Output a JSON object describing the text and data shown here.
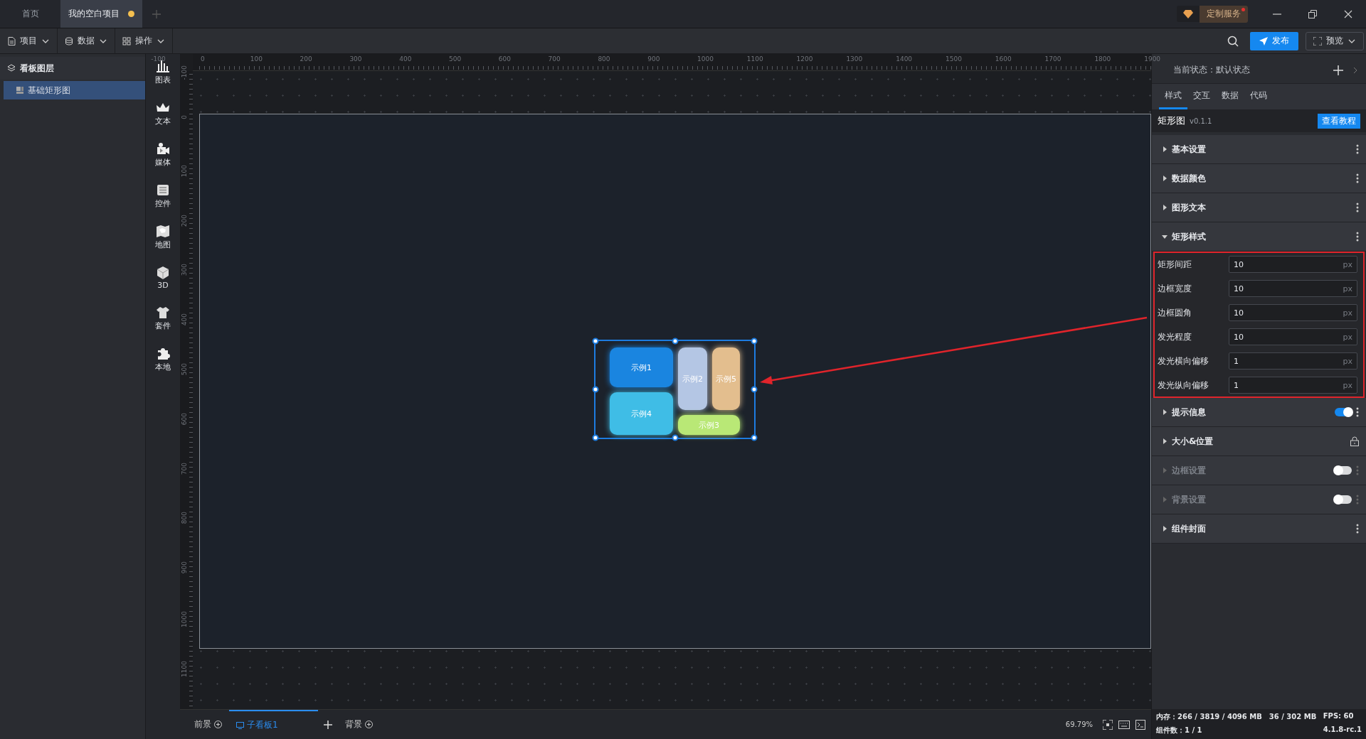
{
  "tabs": [
    {
      "label": "首页",
      "selected": false,
      "modified": false
    },
    {
      "label": "我的空白项目",
      "selected": true,
      "modified": true
    }
  ],
  "custom_service": {
    "label": "定制服务",
    "notify": true
  },
  "toolbar": {
    "menus": [
      "项目",
      "数据",
      "操作"
    ],
    "publish": "发布",
    "preview": "预览"
  },
  "layers": {
    "title": "看板图层",
    "items": [
      {
        "label": "基础矩形图",
        "selected": true
      }
    ]
  },
  "components": [
    "图表",
    "文本",
    "媒体",
    "控件",
    "地图",
    "3D",
    "套件",
    "本地"
  ],
  "ruler": {
    "x_labels": [
      "-100",
      "0",
      "100",
      "200",
      "300",
      "400",
      "500",
      "600",
      "700",
      "800",
      "900",
      "1000",
      "1100",
      "1200",
      "1300",
      "1400",
      "1500",
      "1600",
      "1700",
      "1800",
      "1900"
    ],
    "y_labels": [
      "-100",
      "0",
      "100",
      "200",
      "300",
      "400",
      "500",
      "600",
      "700",
      "800",
      "900",
      "1000",
      "1100"
    ]
  },
  "widget": {
    "selected": true,
    "items": [
      {
        "label": "示例1",
        "color": "#1a85e0"
      },
      {
        "label": "示例2",
        "color": "#b4c6e4"
      },
      {
        "label": "示例5",
        "color": "#e3be8e"
      },
      {
        "label": "示例4",
        "color": "#3fbde6"
      },
      {
        "label": "示例3",
        "color": "#b9e876"
      }
    ]
  },
  "bottom_tabs": [
    {
      "label": "前景",
      "kind": "layer",
      "selected": false
    },
    {
      "label": "子看板1",
      "kind": "board",
      "selected": true
    },
    {
      "label": "背景",
      "kind": "layer",
      "selected": false
    }
  ],
  "zoom": "69.79%",
  "status": {
    "memory": "内存：266 / 3819 / 4096 MB",
    "gpu": "36 / 302 MB",
    "fps": "FPS:  60",
    "count": "组件数：1 / 1",
    "version": "4.1.8-rc.1"
  },
  "panel": {
    "state": "当前状态：默认状态",
    "tabs": [
      {
        "label": "样式",
        "selected": true
      },
      {
        "label": "交互",
        "selected": false
      },
      {
        "label": "数据",
        "selected": false
      },
      {
        "label": "代码",
        "selected": false
      }
    ],
    "component": {
      "name": "矩形图",
      "version": "v0.1.1",
      "tutorial": "查看教程"
    },
    "sections": [
      {
        "label": "基本设置",
        "expanded": false,
        "kind": "menu",
        "disabled": false
      },
      {
        "label": "数据颜色",
        "expanded": false,
        "kind": "menu",
        "disabled": false
      },
      {
        "label": "图形文本",
        "expanded": false,
        "kind": "menu",
        "disabled": false
      },
      {
        "label": "矩形样式",
        "expanded": true,
        "kind": "menu",
        "disabled": false,
        "highlighted": true,
        "fields": [
          {
            "label": "矩形间距",
            "value": "10",
            "unit": "px"
          },
          {
            "label": "边框宽度",
            "value": "10",
            "unit": "px"
          },
          {
            "label": "边框圆角",
            "value": "10",
            "unit": "px"
          },
          {
            "label": "发光程度",
            "value": "10",
            "unit": "px"
          },
          {
            "label": "发光横向偏移",
            "value": "1",
            "unit": "px"
          },
          {
            "label": "发光纵向偏移",
            "value": "1",
            "unit": "px"
          }
        ]
      },
      {
        "label": "提示信息",
        "expanded": false,
        "kind": "toggle",
        "on": true,
        "disabled": false
      },
      {
        "label": "大小&位置",
        "expanded": false,
        "kind": "lock",
        "disabled": false
      },
      {
        "label": "边框设置",
        "expanded": false,
        "kind": "toggle",
        "on": false,
        "disabled": true
      },
      {
        "label": "背景设置",
        "expanded": false,
        "kind": "toggle",
        "on": false,
        "disabled": true
      },
      {
        "label": "组件封面",
        "expanded": false,
        "kind": "menu",
        "disabled": false
      }
    ]
  }
}
